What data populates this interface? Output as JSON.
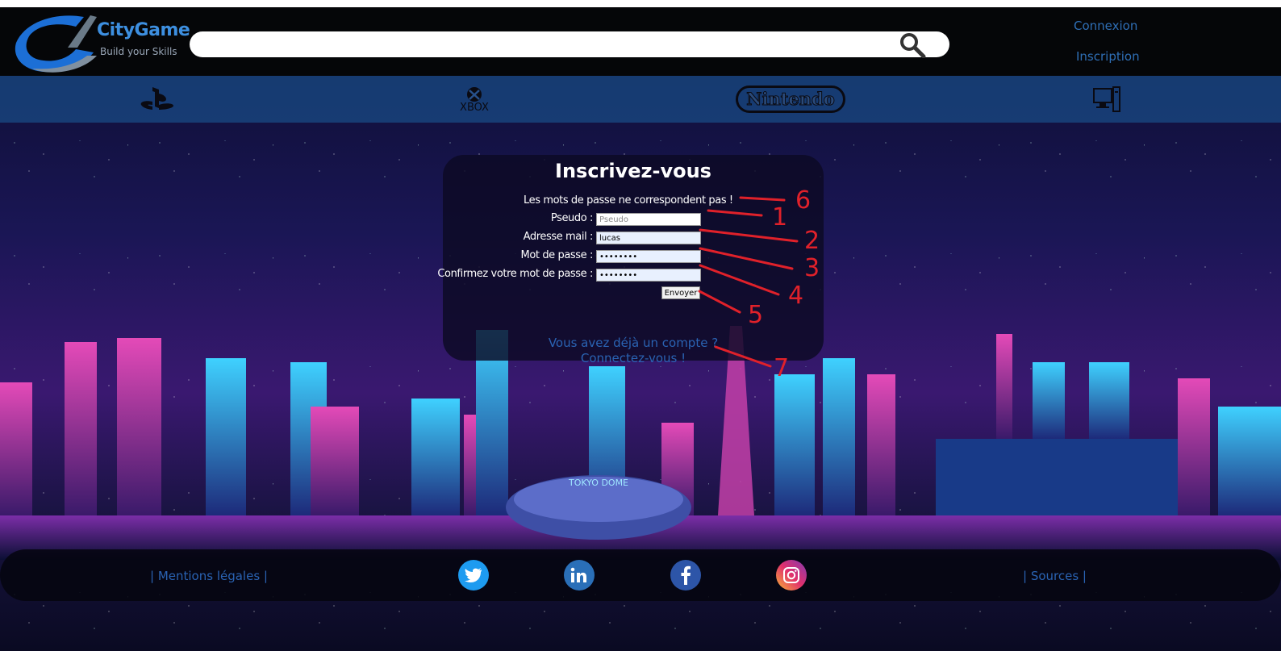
{
  "header": {
    "logo_title": "CityGame",
    "logo_subtitle": "Build your Skills",
    "search_placeholder": "",
    "login_label": "Connexion",
    "signup_label": "Inscription"
  },
  "consoles": {
    "xbox_label": "XBOX",
    "nintendo_label": "Nintendo"
  },
  "form": {
    "title": "Inscrivez-vous",
    "error_message": "Les mots de passe ne correspondent pas !",
    "pseudo_label": "Pseudo :",
    "pseudo_placeholder": "Pseudo",
    "email_label": "Adresse mail :",
    "email_value": "lucas",
    "password_label": "Mot de passe :",
    "password_value": "••••••••",
    "confirm_label": "Confirmez votre mot de passe :",
    "confirm_value": "••••••••",
    "submit_label": "Envoyer",
    "have_account_text": "Vous avez déjà un compte ?",
    "login_link_text": "Connectez-vous !"
  },
  "skyline": {
    "dome_label": "TOKYO DOME"
  },
  "footer": {
    "legal_label": "| Mentions légales |",
    "sources_label": "| Sources |",
    "social": [
      "twitter-icon",
      "linkedin-icon",
      "facebook-icon",
      "instagram-icon"
    ]
  },
  "annotations": {
    "numbers": [
      "1",
      "2",
      "3",
      "4",
      "5",
      "6",
      "7"
    ],
    "color": "#e0212a"
  },
  "colors": {
    "accent_blue": "#2a63b3",
    "topbar_bg": "#050608",
    "console_bar_bg": "#184882"
  }
}
